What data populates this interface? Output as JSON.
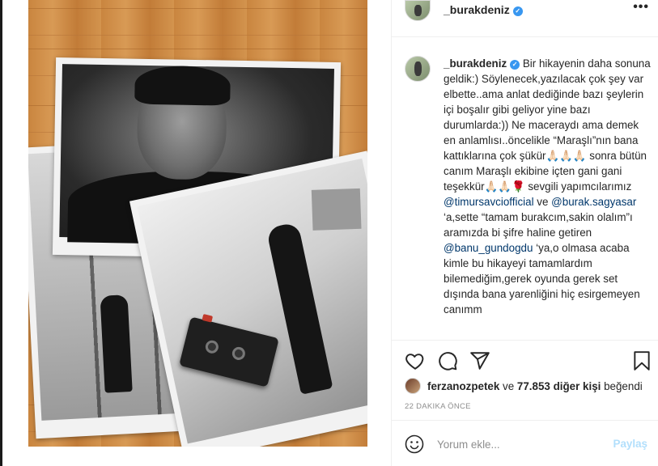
{
  "post": {
    "username": "_burakdeniz",
    "verified_mark": "✓",
    "more_label": "•••"
  },
  "caption": {
    "username": "_burakdeniz",
    "segments": [
      {
        "type": "text",
        "text": " Bir hikayenin daha sonuna geldik:) Söylenecek,yazılacak çok şey var elbette..ama anlat dediğinde bazı şeylerin içi boşalır gibi geliyor yine bazı durumlarda:)) Ne maceraydı ama demek en anlamlısı..öncelikle “Maraşlı”nın bana kattıklarına çok şükür🙏🏻🙏🏻🙏🏻 sonra bütün canım Maraşlı ekibine içten gani gani teşekkür🙏🏻🙏🏻🌹 sevgili yapımcılarımız "
      },
      {
        "type": "mention",
        "text": "@timursavciofficial"
      },
      {
        "type": "text",
        "text": " ve "
      },
      {
        "type": "mention",
        "text": "@burak.sagyasar"
      },
      {
        "type": "text",
        "text": " ‘a,sette “tamam burakcım,sakin olalım”ı aramızda bi şifre haline getiren "
      },
      {
        "type": "mention",
        "text": "@banu_gundogdu"
      },
      {
        "type": "text",
        "text": " ‘ya,o olmasa acaba kimle bu hikayeyi tamamlardım bilemediğim,gerek oyunda gerek set dışında bana yarenliğini hiç esirgemeyen canımm"
      }
    ]
  },
  "likes": {
    "liker": "ferzanozpetek",
    "connector": " ve ",
    "count_text": "77.853 diğer kişi",
    "suffix": " beğendi"
  },
  "timestamp": "22 dakika önce",
  "comment": {
    "placeholder": "Yorum ekle...",
    "post_label": "Paylaş"
  },
  "icons": {
    "like": "heart-icon",
    "comment": "comment-icon",
    "share": "share-icon",
    "save": "bookmark-icon",
    "emoji": "emoji-icon"
  },
  "colors": {
    "link": "#00376b",
    "verified": "#3897f0",
    "post_button_disabled": "#b2dffc",
    "muted": "#8e8e8e"
  }
}
